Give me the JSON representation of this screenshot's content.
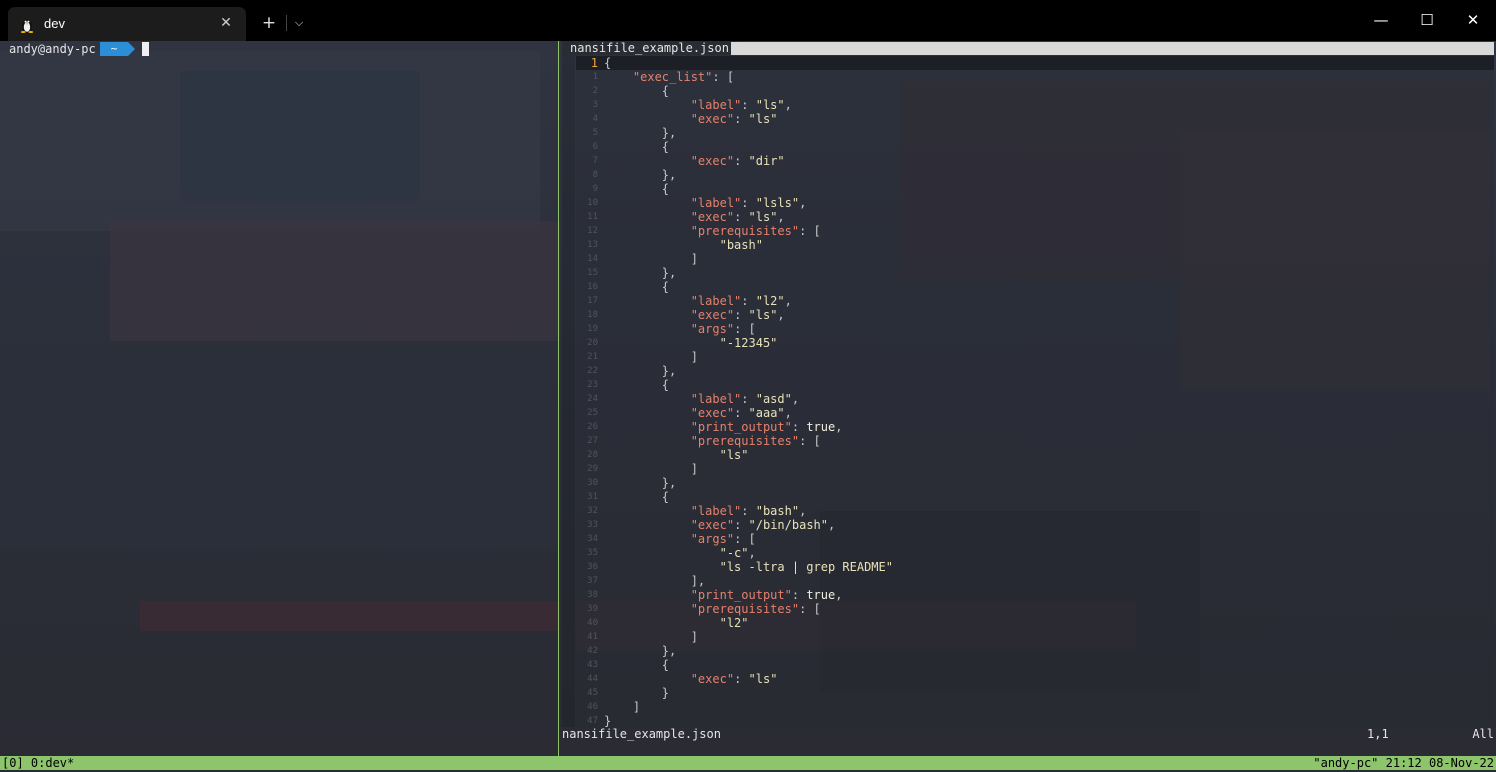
{
  "tab": {
    "title": "dev",
    "icon": "linux-penguin-icon"
  },
  "titlebar": {
    "new_tab": "+",
    "dropdown": "⌵",
    "minimize": "—",
    "maximize": "☐",
    "close": "✕",
    "tab_close": "✕"
  },
  "terminal": {
    "prompt_user": "andy@andy-pc",
    "prompt_dir": "~"
  },
  "editor": {
    "tab_label": "nansifile_example.json",
    "current_line_number": "1",
    "lines": [
      [
        [
          "p",
          "{"
        ]
      ],
      [
        [
          "p",
          "    "
        ],
        [
          "k",
          "\"exec_list\""
        ],
        [
          "p",
          ": ["
        ]
      ],
      [
        [
          "p",
          "        {"
        ]
      ],
      [
        [
          "p",
          "            "
        ],
        [
          "k",
          "\"label\""
        ],
        [
          "p",
          ": "
        ],
        [
          "s",
          "\"ls\""
        ],
        [
          "p",
          ","
        ]
      ],
      [
        [
          "p",
          "            "
        ],
        [
          "k",
          "\"exec\""
        ],
        [
          "p",
          ": "
        ],
        [
          "s",
          "\"ls\""
        ]
      ],
      [
        [
          "p",
          "        },"
        ]
      ],
      [
        [
          "p",
          "        {"
        ]
      ],
      [
        [
          "p",
          "            "
        ],
        [
          "k",
          "\"exec\""
        ],
        [
          "p",
          ": "
        ],
        [
          "s",
          "\"dir\""
        ]
      ],
      [
        [
          "p",
          "        },"
        ]
      ],
      [
        [
          "p",
          "        {"
        ]
      ],
      [
        [
          "p",
          "            "
        ],
        [
          "k",
          "\"label\""
        ],
        [
          "p",
          ": "
        ],
        [
          "s",
          "\"lsls\""
        ],
        [
          "p",
          ","
        ]
      ],
      [
        [
          "p",
          "            "
        ],
        [
          "k",
          "\"exec\""
        ],
        [
          "p",
          ": "
        ],
        [
          "s",
          "\"ls\""
        ],
        [
          "p",
          ","
        ]
      ],
      [
        [
          "p",
          "            "
        ],
        [
          "k",
          "\"prerequisites\""
        ],
        [
          "p",
          ": ["
        ]
      ],
      [
        [
          "p",
          "                "
        ],
        [
          "s",
          "\"bash\""
        ]
      ],
      [
        [
          "p",
          "            ]"
        ]
      ],
      [
        [
          "p",
          "        },"
        ]
      ],
      [
        [
          "p",
          "        {"
        ]
      ],
      [
        [
          "p",
          "            "
        ],
        [
          "k",
          "\"label\""
        ],
        [
          "p",
          ": "
        ],
        [
          "s",
          "\"l2\""
        ],
        [
          "p",
          ","
        ]
      ],
      [
        [
          "p",
          "            "
        ],
        [
          "k",
          "\"exec\""
        ],
        [
          "p",
          ": "
        ],
        [
          "s",
          "\"ls\""
        ],
        [
          "p",
          ","
        ]
      ],
      [
        [
          "p",
          "            "
        ],
        [
          "k",
          "\"args\""
        ],
        [
          "p",
          ": ["
        ]
      ],
      [
        [
          "p",
          "                "
        ],
        [
          "s",
          "\"-12345\""
        ]
      ],
      [
        [
          "p",
          "            ]"
        ]
      ],
      [
        [
          "p",
          "        },"
        ]
      ],
      [
        [
          "p",
          "        {"
        ]
      ],
      [
        [
          "p",
          "            "
        ],
        [
          "k",
          "\"label\""
        ],
        [
          "p",
          ": "
        ],
        [
          "s",
          "\"asd\""
        ],
        [
          "p",
          ","
        ]
      ],
      [
        [
          "p",
          "            "
        ],
        [
          "k",
          "\"exec\""
        ],
        [
          "p",
          ": "
        ],
        [
          "s",
          "\"aaa\""
        ],
        [
          "p",
          ","
        ]
      ],
      [
        [
          "p",
          "            "
        ],
        [
          "k",
          "\"print_output\""
        ],
        [
          "p",
          ": "
        ],
        [
          "b",
          "true"
        ],
        [
          "p",
          ","
        ]
      ],
      [
        [
          "p",
          "            "
        ],
        [
          "k",
          "\"prerequisites\""
        ],
        [
          "p",
          ": ["
        ]
      ],
      [
        [
          "p",
          "                "
        ],
        [
          "s",
          "\"ls\""
        ]
      ],
      [
        [
          "p",
          "            ]"
        ]
      ],
      [
        [
          "p",
          "        },"
        ]
      ],
      [
        [
          "p",
          "        {"
        ]
      ],
      [
        [
          "p",
          "            "
        ],
        [
          "k",
          "\"label\""
        ],
        [
          "p",
          ": "
        ],
        [
          "s",
          "\"bash\""
        ],
        [
          "p",
          ","
        ]
      ],
      [
        [
          "p",
          "            "
        ],
        [
          "k",
          "\"exec\""
        ],
        [
          "p",
          ": "
        ],
        [
          "s",
          "\"/bin/bash\""
        ],
        [
          "p",
          ","
        ]
      ],
      [
        [
          "p",
          "            "
        ],
        [
          "k",
          "\"args\""
        ],
        [
          "p",
          ": ["
        ]
      ],
      [
        [
          "p",
          "                "
        ],
        [
          "s",
          "\"-c\""
        ],
        [
          "p",
          ","
        ]
      ],
      [
        [
          "p",
          "                "
        ],
        [
          "s",
          "\"ls -ltra | grep README\""
        ]
      ],
      [
        [
          "p",
          "            ],"
        ]
      ],
      [
        [
          "p",
          "            "
        ],
        [
          "k",
          "\"print_output\""
        ],
        [
          "p",
          ": "
        ],
        [
          "b",
          "true"
        ],
        [
          "p",
          ","
        ]
      ],
      [
        [
          "p",
          "            "
        ],
        [
          "k",
          "\"prerequisites\""
        ],
        [
          "p",
          ": ["
        ]
      ],
      [
        [
          "p",
          "                "
        ],
        [
          "s",
          "\"l2\""
        ]
      ],
      [
        [
          "p",
          "            ]"
        ]
      ],
      [
        [
          "p",
          "        },"
        ]
      ],
      [
        [
          "p",
          "        {"
        ]
      ],
      [
        [
          "p",
          "            "
        ],
        [
          "k",
          "\"exec\""
        ],
        [
          "p",
          ": "
        ],
        [
          "s",
          "\"ls\""
        ]
      ],
      [
        [
          "p",
          "        }"
        ]
      ],
      [
        [
          "p",
          "    ]"
        ]
      ],
      [
        [
          "p",
          "}"
        ]
      ]
    ],
    "status": {
      "filename": "nansifile_example.json",
      "position": "1,1",
      "scroll": "All"
    }
  },
  "tmux": {
    "left": "[0] 0:dev*",
    "right": "\"andy-pc\" 21:12 08-Nov-22"
  },
  "colors": {
    "tmux_bar": "#8cc56c",
    "prompt_dir_bg": "#2b8fd8",
    "json_key": "#e5816c",
    "json_string": "#e8e2b8"
  }
}
